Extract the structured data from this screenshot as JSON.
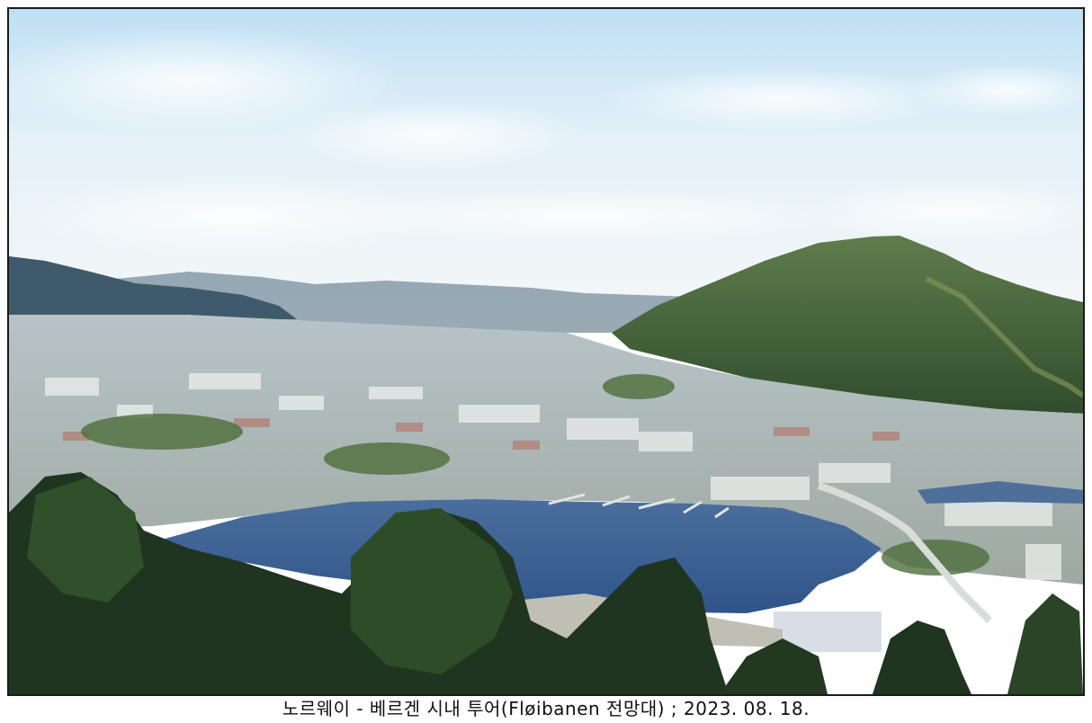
{
  "photo": {
    "subject": "Bergen city view from Fløyen"
  },
  "caption": {
    "text": "노르웨이 - 베르겐 시내 투어(Fløibanen 전망대) ; 2023. 08. 18."
  }
}
